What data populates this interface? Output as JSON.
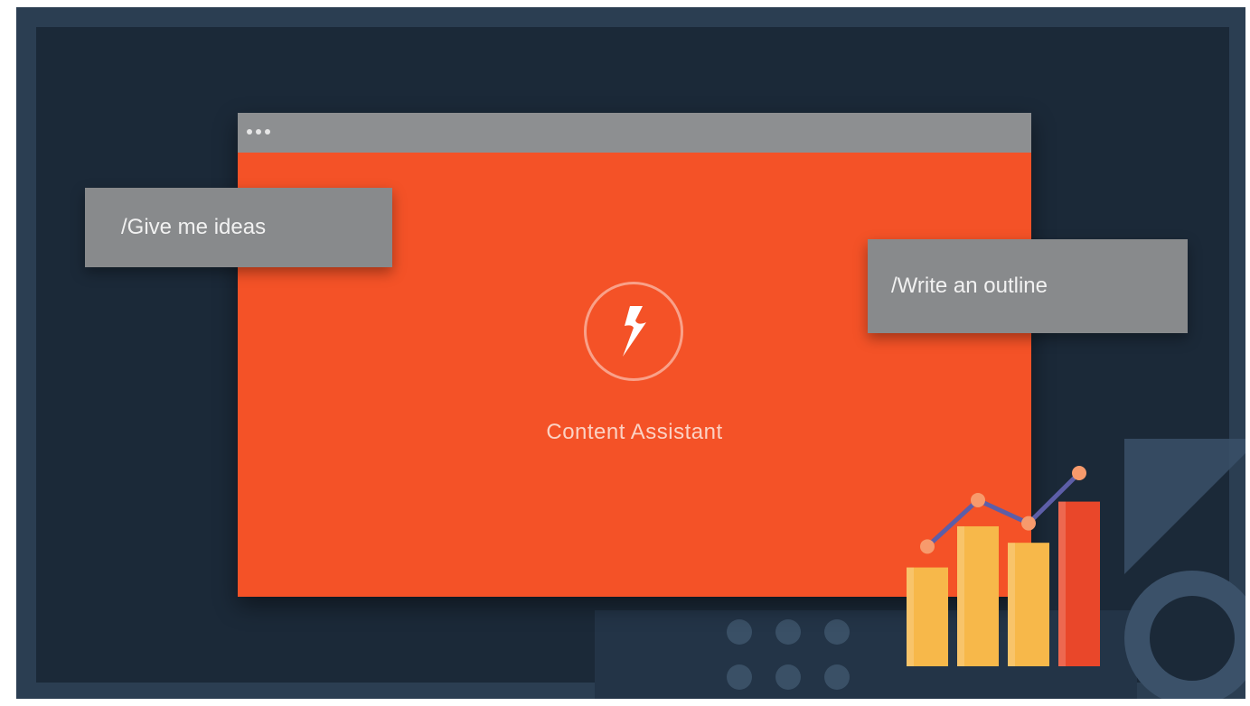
{
  "scene": {
    "colors": {
      "stage_outer": "#2b3e52",
      "stage_inner": "#1b2938",
      "window_body": "#f45227",
      "titlebar": "#8d8f91",
      "chip": "#888a8c",
      "bar_yellow": "#f7b84a",
      "bar_red": "#e9472a",
      "trend_line": "#5d5ea8"
    }
  },
  "app_window": {
    "assistant_icon": "lightning-bolt-icon",
    "assistant_label": "Content Assistant"
  },
  "commands": [
    {
      "label": "/Give me ideas"
    },
    {
      "label": "/Write an outline"
    }
  ],
  "illustration": {
    "bars": [
      {
        "level": 0.48,
        "color": "#f7b84a"
      },
      {
        "level": 0.68,
        "color": "#f7b84a"
      },
      {
        "level": 0.6,
        "color": "#f7b84a"
      },
      {
        "level": 0.8,
        "color": "#e9472a"
      }
    ],
    "trend_points": [
      0.62,
      0.86,
      0.74,
      1.0
    ]
  }
}
